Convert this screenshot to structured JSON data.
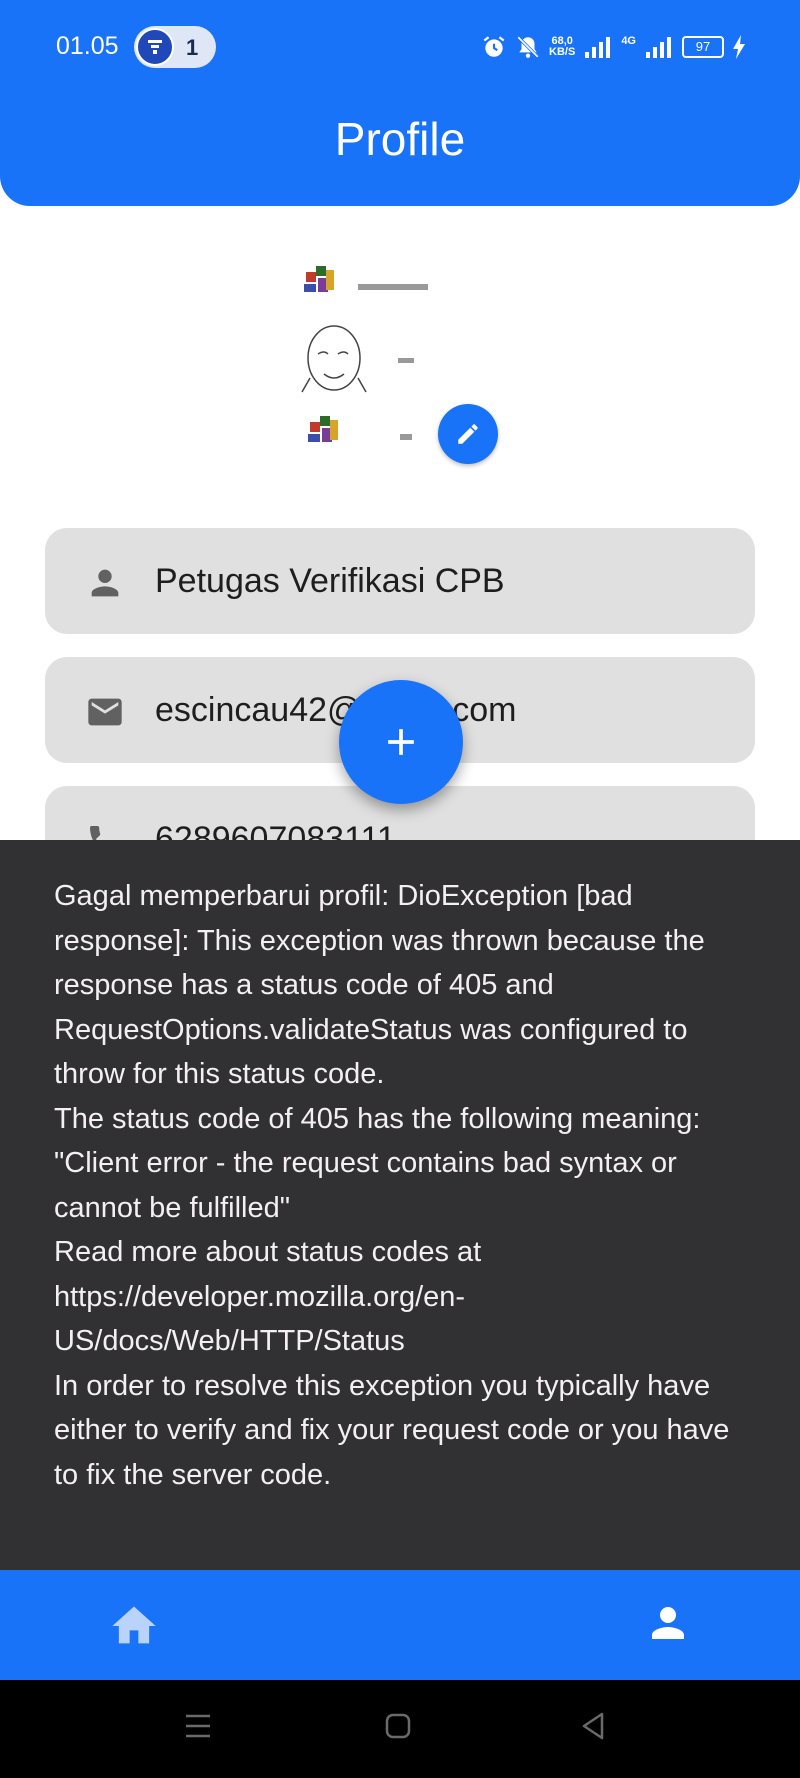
{
  "status_bar": {
    "time": "01.05",
    "notification_count": "1",
    "network_speed_value": "68,0",
    "network_speed_unit": "KB/S",
    "network_type": "4G",
    "battery": "97",
    "icons": [
      "alarm-icon",
      "mute-icon",
      "signal-icon",
      "signal-4g-icon",
      "battery-icon",
      "charging-icon"
    ]
  },
  "header": {
    "title": "Profile"
  },
  "profile": {
    "name": "Petugas Verifikasi CPB",
    "email": "escincau42@gmail.com",
    "phone": "6289607083111",
    "avatar_icon": "profile-photo",
    "edit_icon": "edit-pencil-icon"
  },
  "fab": {
    "icon": "add-icon"
  },
  "snackbar": {
    "message": "Gagal memperbarui profil: DioException [bad response]: This exception was thrown because the response has a status code of 405 and RequestOptions.validateStatus was configured to throw for this status code.\nThe status code of 405 has the following meaning: \"Client error - the request contains bad syntax or cannot be fulfilled\"\nRead more about status codes at https://developer.mozilla.org/en-US/docs/Web/HTTP/Status\nIn order to resolve this exception you typically have either to verify and fix your request code or you have to fix the server code."
  },
  "bottom_nav": {
    "items": [
      {
        "icon": "home-icon"
      },
      {
        "icon": "person-icon"
      }
    ]
  },
  "colors": {
    "primary": "#1873f8",
    "field_bg": "#e0e0e0",
    "snackbar_bg": "#313033",
    "text_dark": "#1e1e1e"
  }
}
